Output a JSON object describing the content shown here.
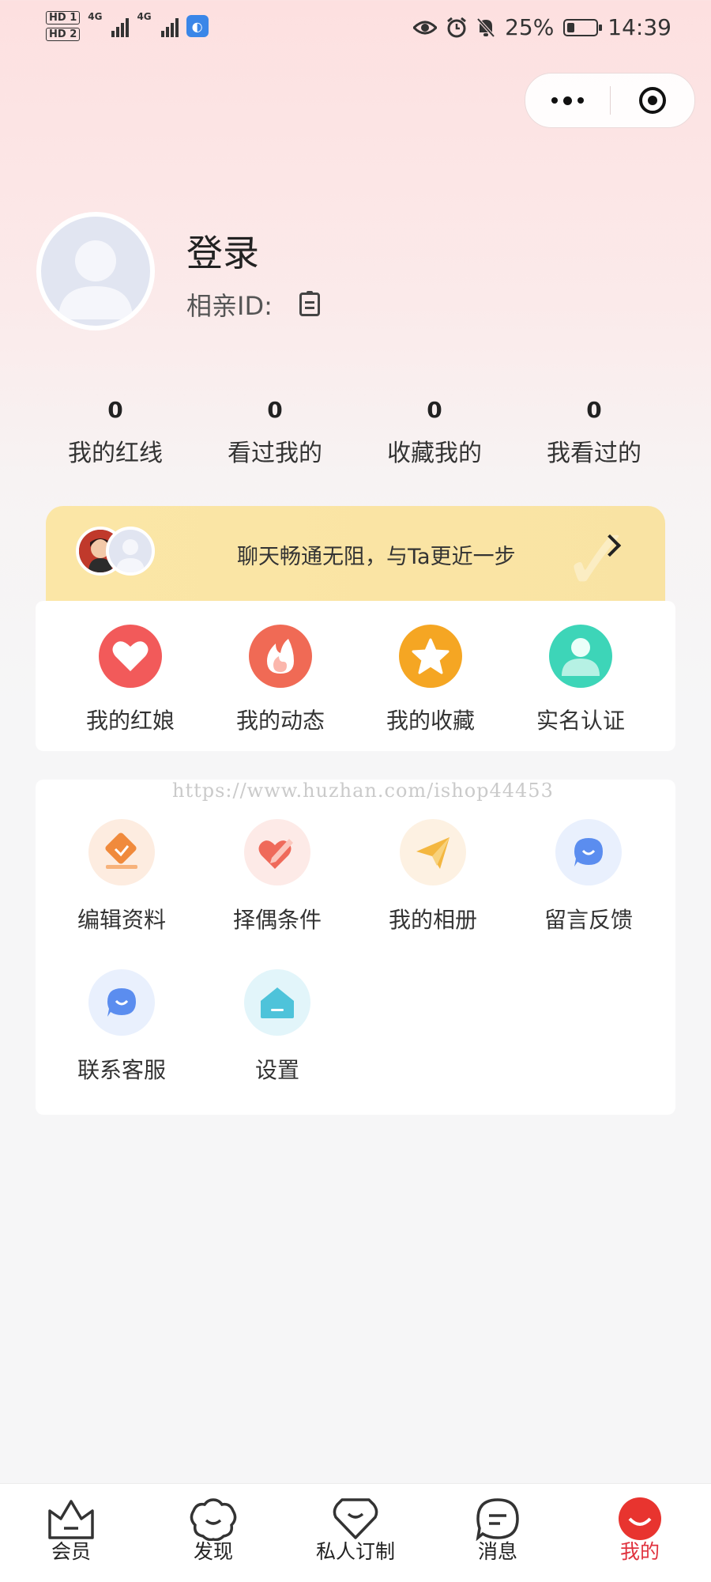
{
  "status_bar": {
    "hd1": "HD 1",
    "hd2": "HD 2",
    "net1": "4G",
    "net2": "4G",
    "battery": "25%",
    "battery_level": 0.25,
    "time": "14:39"
  },
  "profile": {
    "login_label": "登录",
    "id_label": "相亲ID:"
  },
  "stats": [
    {
      "value": "0",
      "label": "我的红线"
    },
    {
      "value": "0",
      "label": "看过我的"
    },
    {
      "value": "0",
      "label": "收藏我的"
    },
    {
      "value": "0",
      "label": "我看过的"
    }
  ],
  "banner": {
    "text": "聊天畅通无阻，与Ta更近一步"
  },
  "quick_actions": [
    {
      "label": "我的红娘",
      "icon": "heart-icon",
      "color": "#f25a5a"
    },
    {
      "label": "我的动态",
      "icon": "flame-icon",
      "color": "#f06a55"
    },
    {
      "label": "我的收藏",
      "icon": "star-icon",
      "color": "#f5a623"
    },
    {
      "label": "实名认证",
      "icon": "user-verify-icon",
      "color": "#3dd5b8"
    }
  ],
  "watermark": "https://www.huzhan.com/ishop44453",
  "services": [
    {
      "label": "编辑资料",
      "icon": "edit-profile-icon",
      "color": "#f08a3c"
    },
    {
      "label": "择偶条件",
      "icon": "heart-pen-icon",
      "color": "#ef6a5a"
    },
    {
      "label": "我的相册",
      "icon": "paper-plane-icon",
      "color": "#f4b740"
    },
    {
      "label": "留言反馈",
      "icon": "chat-bubble-icon",
      "color": "#5b8def"
    },
    {
      "label": "联系客服",
      "icon": "customer-service-icon",
      "color": "#5b8def"
    },
    {
      "label": "设置",
      "icon": "settings-home-icon",
      "color": "#4ec3da"
    }
  ],
  "tabs": [
    {
      "label": "会员",
      "icon": "crown-icon",
      "active": false
    },
    {
      "label": "发现",
      "icon": "discover-icon",
      "active": false
    },
    {
      "label": "私人订制",
      "icon": "custom-icon",
      "active": false
    },
    {
      "label": "消息",
      "icon": "message-icon",
      "active": false
    },
    {
      "label": "我的",
      "icon": "me-icon",
      "active": true
    }
  ],
  "colors": {
    "accent": "#e0323e",
    "banner": "#fbe6a6"
  }
}
